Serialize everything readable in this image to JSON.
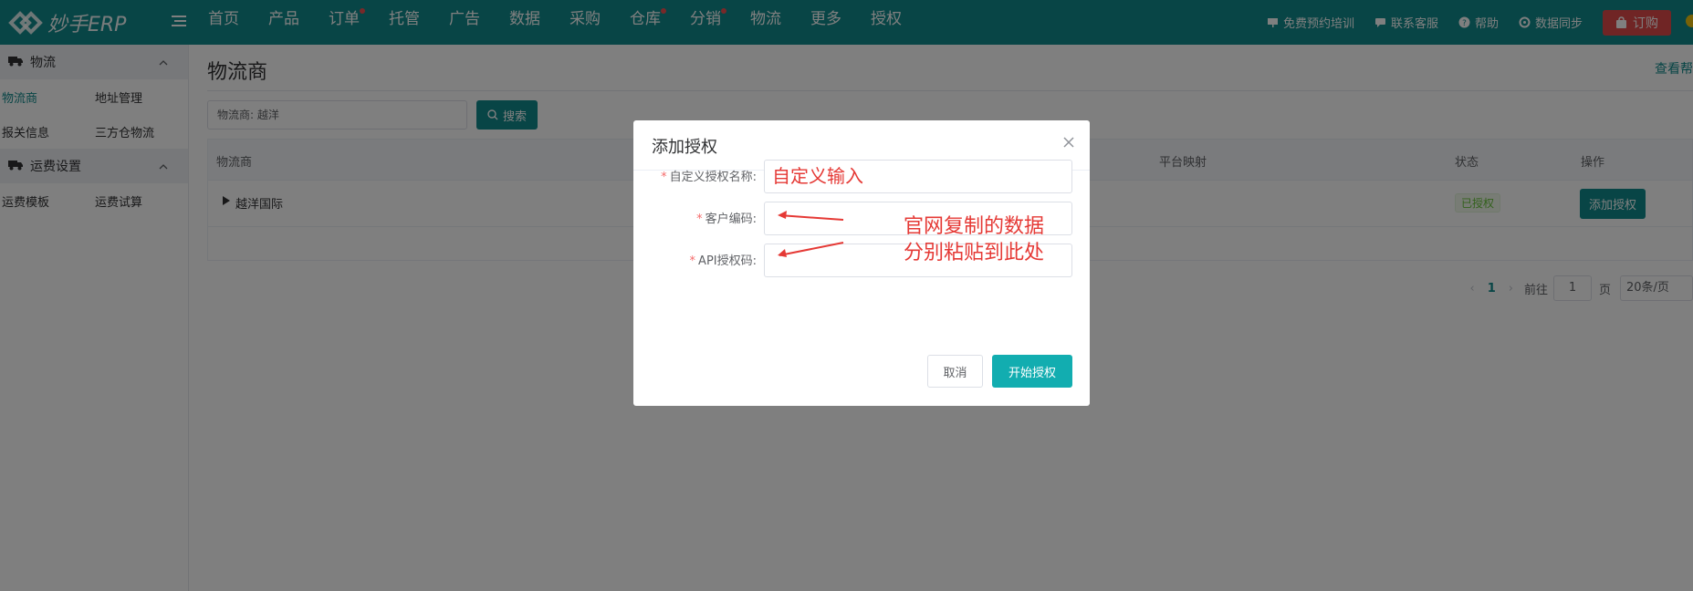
{
  "app": {
    "logo_text": "妙手ERP"
  },
  "topnav": {
    "items": [
      {
        "label": "首页",
        "dot": false
      },
      {
        "label": "产品",
        "dot": false
      },
      {
        "label": "订单",
        "dot": true
      },
      {
        "label": "托管",
        "dot": false
      },
      {
        "label": "广告",
        "dot": false
      },
      {
        "label": "数据",
        "dot": false
      },
      {
        "label": "采购",
        "dot": false
      },
      {
        "label": "仓库",
        "dot": true
      },
      {
        "label": "分销",
        "dot": true
      },
      {
        "label": "物流",
        "dot": false
      },
      {
        "label": "更多",
        "dot": false
      },
      {
        "label": "授权",
        "dot": false
      }
    ],
    "right": {
      "training": "免费预约培训",
      "support": "联系客服",
      "help": "帮助",
      "sync": "数据同步",
      "order": "订购"
    }
  },
  "sidebar": {
    "group1": {
      "title": "物流",
      "links": [
        "物流商",
        "地址管理",
        "报关信息",
        "三方仓物流"
      ]
    },
    "group2": {
      "title": "运费设置",
      "links": [
        "运费模板",
        "运费试算"
      ]
    }
  },
  "main": {
    "title": "物流商",
    "help_link": "查看帮",
    "search_value": "物流商:  越洋",
    "search_button": "搜索",
    "table": {
      "headers": [
        "物流商",
        "平台映射",
        "状态",
        "操作"
      ],
      "rows": [
        {
          "name": "越洋国际",
          "status": "已授权",
          "action": "添加授权"
        }
      ]
    },
    "pager": {
      "page": "1",
      "goto": "前往",
      "page_input": "1",
      "page_unit": "页",
      "size": "20条/页"
    }
  },
  "modal": {
    "title": "添加授权",
    "fields": [
      {
        "label": "自定义授权名称:",
        "value": "自定义输入"
      },
      {
        "label": "客户编码:",
        "value": ""
      },
      {
        "label": "API授权码:",
        "value": ""
      }
    ],
    "annotation_line1": "官网复制的数据",
    "annotation_line2": "分别粘贴到此处",
    "cancel": "取消",
    "confirm": "开始授权"
  }
}
